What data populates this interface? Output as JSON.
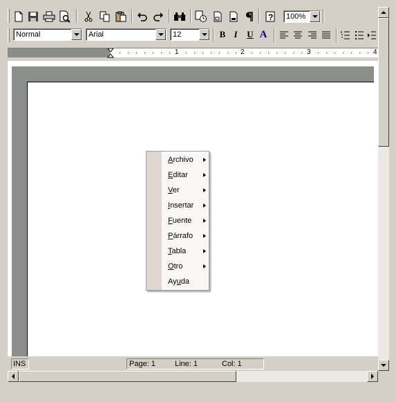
{
  "toolbar": {
    "zoom": "100%",
    "style": "Normal",
    "font": "Arial",
    "size": "12",
    "bold": "B",
    "italic": "I",
    "underline": "U",
    "color_a": "A"
  },
  "ruler": {
    "marks": [
      "1",
      "2",
      "3",
      "4"
    ]
  },
  "context_menu": {
    "items": [
      {
        "mnemonic": "A",
        "rest": "rchivo",
        "submenu": true
      },
      {
        "mnemonic": "E",
        "rest": "ditar",
        "submenu": true
      },
      {
        "mnemonic": "V",
        "rest": "er",
        "submenu": true
      },
      {
        "mnemonic": "I",
        "rest": "nsertar",
        "submenu": true
      },
      {
        "mnemonic": "F",
        "rest": "uente",
        "submenu": true
      },
      {
        "mnemonic": "P",
        "rest": "árrafo",
        "submenu": true
      },
      {
        "mnemonic": "T",
        "rest": "abla",
        "submenu": true
      },
      {
        "mnemonic": "O",
        "rest": "tro",
        "submenu": true
      },
      {
        "prefix": "Ay",
        "mnemonic": "u",
        "rest": "da",
        "submenu": false
      }
    ]
  },
  "status": {
    "mode": "INS",
    "page": "Page: 1",
    "line": "Line: 1",
    "col": "Col: 1"
  }
}
